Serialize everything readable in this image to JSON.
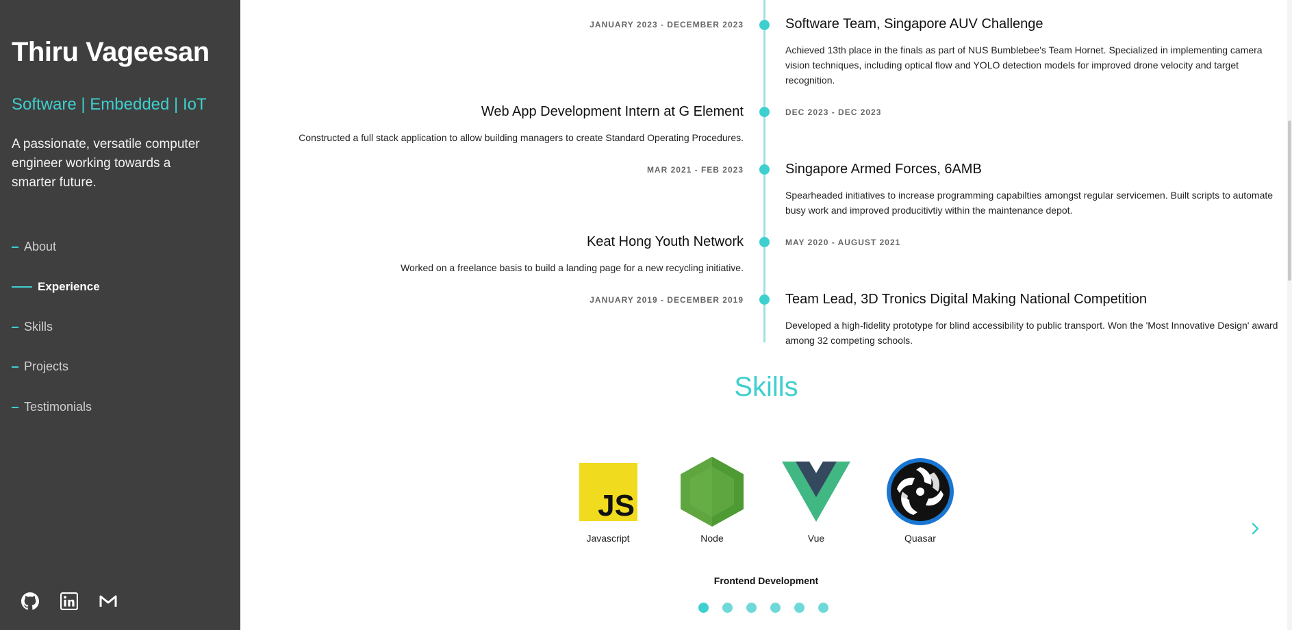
{
  "profile": {
    "name": "Thiru Vageesan",
    "tagline": "Software | Embedded | IoT",
    "bio": "A passionate, versatile computer engineer working towards a smarter future."
  },
  "nav": {
    "items": [
      {
        "label": "About",
        "active": false
      },
      {
        "label": "Experience",
        "active": true
      },
      {
        "label": "Skills",
        "active": false
      },
      {
        "label": "Projects",
        "active": false
      },
      {
        "label": "Testimonials",
        "active": false
      }
    ]
  },
  "socials": {
    "github": "github-icon",
    "linkedin": "linkedin-icon",
    "gmail": "gmail-icon"
  },
  "experience": [
    {
      "date": "JANUARY 2023 - DECEMBER 2023",
      "title": "Software Team, Singapore AUV Challenge",
      "description": "Achieved 13th place in the finals as part of NUS Bumblebee's Team Hornet. Specialized in implementing camera vision techniques, including optical flow and YOLO detection models for improved drone velocity and target recognition."
    },
    {
      "date": "DEC 2023 - DEC 2023",
      "title": "Web App Development Intern at G Element",
      "description": "Constructed a full stack application to allow building managers to create Standard Operating Procedures."
    },
    {
      "date": "MAR 2021 - FEB 2023",
      "title": "Singapore Armed Forces, 6AMB",
      "description": "Spearheaded initiatives to increase programming capabilties amongst regular servicemen. Built scripts to automate busy work and improved producitivtiy within the maintenance depot."
    },
    {
      "date": "MAY 2020 - AUGUST 2021",
      "title": "Keat Hong Youth Network",
      "description": "Worked on a freelance basis to build a landing page for a new recycling initiative."
    },
    {
      "date": "JANUARY 2019 - DECEMBER 2019",
      "title": "Team Lead, 3D Tronics Digital Making National Competition",
      "description": "Developed a high-fidelity prototype for blind accessibility to public transport. Won the 'Most Innovative Design' award among 32 competing schools."
    }
  ],
  "skills": {
    "heading": "Skills",
    "items": [
      {
        "label": "Javascript",
        "icon": "javascript-icon"
      },
      {
        "label": "Node",
        "icon": "nodejs-icon"
      },
      {
        "label": "Vue",
        "icon": "vue-icon"
      },
      {
        "label": "Quasar",
        "icon": "quasar-icon"
      }
    ],
    "category": "Frontend Development",
    "page_count": 6,
    "active_page": 1,
    "next_icon": "chevron-right-icon"
  },
  "colors": {
    "accent": "#3ecfcf",
    "sidebar_bg": "#3f3f3f"
  }
}
